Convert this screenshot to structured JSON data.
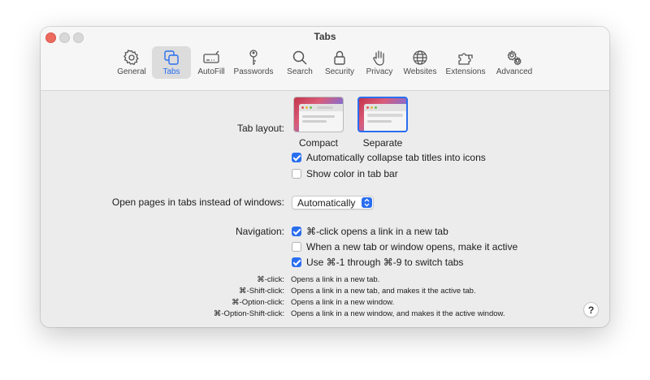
{
  "window": {
    "title": "Tabs"
  },
  "toolbar": {
    "items": [
      {
        "label": "General",
        "icon": "gear-icon"
      },
      {
        "label": "Tabs",
        "icon": "tabs-icon",
        "active": true
      },
      {
        "label": "AutoFill",
        "icon": "autofill-icon"
      },
      {
        "label": "Passwords",
        "icon": "key-icon"
      },
      {
        "label": "Search",
        "icon": "search-icon"
      },
      {
        "label": "Security",
        "icon": "lock-icon"
      },
      {
        "label": "Privacy",
        "icon": "hand-icon"
      },
      {
        "label": "Websites",
        "icon": "globe-icon"
      },
      {
        "label": "Extensions",
        "icon": "puzzle-icon"
      },
      {
        "label": "Advanced",
        "icon": "gears-icon"
      }
    ]
  },
  "tab_layout": {
    "label": "Tab layout:",
    "options": [
      {
        "label": "Compact",
        "selected": false
      },
      {
        "label": "Separate",
        "selected": true
      }
    ],
    "checkboxes": [
      {
        "label": "Automatically collapse tab titles into icons",
        "checked": true
      },
      {
        "label": "Show color in tab bar",
        "checked": false
      }
    ]
  },
  "open_pages": {
    "label": "Open pages in tabs instead of windows:",
    "value": "Automatically"
  },
  "navigation": {
    "label": "Navigation:",
    "checkboxes": [
      {
        "label": "⌘-click opens a link in a new tab",
        "checked": true
      },
      {
        "label": "When a new tab or window opens, make it active",
        "checked": false
      },
      {
        "label": "Use ⌘-1 through ⌘-9 to switch tabs",
        "checked": true
      }
    ]
  },
  "shortcuts": [
    {
      "key": "⌘-click:",
      "desc": "Opens a link in a new tab."
    },
    {
      "key": "⌘-Shift-click:",
      "desc": "Opens a link in a new tab, and makes it the active tab."
    },
    {
      "key": "⌘-Option-click:",
      "desc": "Opens a link in a new window."
    },
    {
      "key": "⌘-Option-Shift-click:",
      "desc": "Opens a link in a new window, and makes it the active window."
    }
  ],
  "help": {
    "label": "?"
  },
  "colors": {
    "accent": "#2a6ef0",
    "close": "#ed6a5e"
  }
}
